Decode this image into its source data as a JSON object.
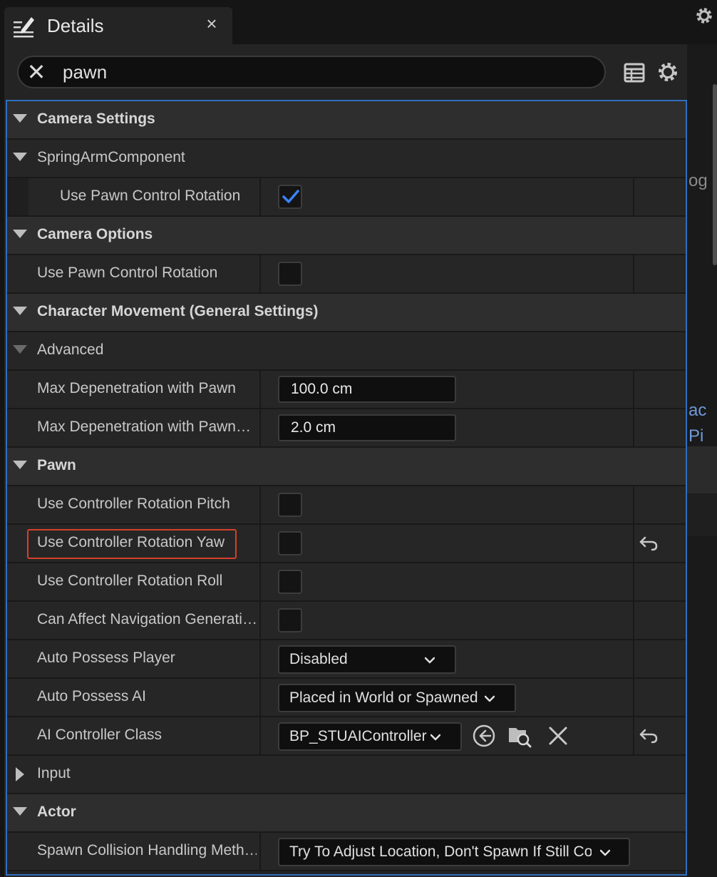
{
  "tab": {
    "title": "Details",
    "close": "×",
    "icon": "details-pencil-icon"
  },
  "search": {
    "value": "pawn",
    "clear": "✕"
  },
  "toolbar": {
    "grid_icon": "property-matrix-icon",
    "settings_icon": "gear-icon"
  },
  "right_strip": {
    "text1": "og",
    "link1": "ac",
    "link2": "Pi"
  },
  "colors": {
    "accent": "#2f6fbf",
    "checkmark": "#3b82f6",
    "highlight": "#d6402a"
  },
  "rows": {
    "camera_settings": "Camera Settings",
    "spring_arm": "SpringArmComponent",
    "spring_use_pawn_control": "Use Pawn Control Rotation",
    "camera_options": "Camera Options",
    "camera_use_pawn_control": "Use Pawn Control Rotation",
    "char_movement": "Character Movement (General Settings)",
    "advanced": "Advanced",
    "max_depen_pawn": "Max Depenetration with Pawn",
    "max_depen_pawn_value": "100.0 cm",
    "max_depen_pawn2": "Max Depenetration with Pawn…",
    "max_depen_pawn2_value": "2.0 cm",
    "pawn": "Pawn",
    "use_ctrl_pitch": "Use Controller Rotation Pitch",
    "use_ctrl_yaw": "Use Controller Rotation Yaw",
    "use_ctrl_roll": "Use Controller Rotation Roll",
    "can_affect_nav": "Can Affect Navigation Generati…",
    "auto_possess_player": "Auto Possess Player",
    "auto_possess_player_value": "Disabled",
    "auto_possess_ai": "Auto Possess AI",
    "auto_possess_ai_value": "Placed in World or Spawned",
    "ai_controller_class": "AI Controller Class",
    "ai_controller_class_value": "BP_STUAIController",
    "input": "Input",
    "actor": "Actor",
    "spawn_collision": "Spawn Collision Handling Meth…",
    "spawn_collision_value": "Try To Adjust Location, Don't Spawn If Still Co"
  }
}
